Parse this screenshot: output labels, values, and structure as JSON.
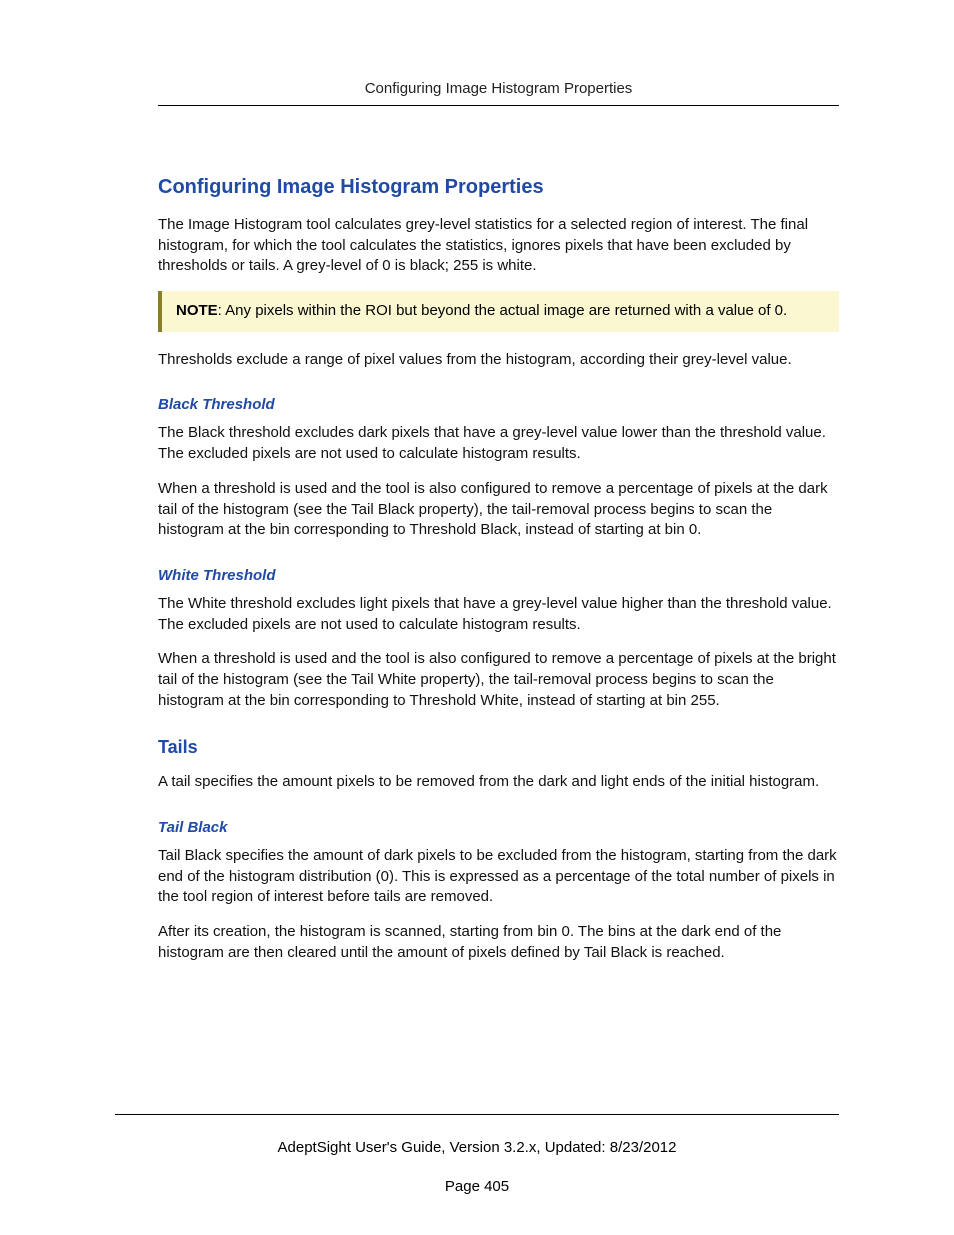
{
  "header": {
    "running_title": "Configuring Image Histogram Properties"
  },
  "content": {
    "h1": "Configuring Image Histogram Properties",
    "intro": "The Image Histogram tool calculates grey-level statistics for a selected region of interest. The final histogram, for which the tool calculates the statistics, ignores pixels that have been excluded by thresholds or tails. A grey-level of 0 is black; 255 is white.",
    "note_label": "NOTE",
    "note_text": ": Any pixels within the ROI but beyond the actual image are returned with a value of 0.",
    "thresholds_intro": "Thresholds exclude a range of pixel values from the histogram, according their grey-level value.",
    "black_threshold": {
      "heading": "Black Threshold",
      "p1": "The Black threshold excludes dark pixels that have a grey-level value lower than the threshold value. The excluded pixels are not used to calculate histogram results.",
      "p2": "When a threshold is used and the tool is also configured to remove a percentage of pixels at the dark tail of the histogram (see the Tail Black property), the tail-removal process begins to scan the histogram at the bin corresponding to Threshold Black, instead of starting at bin 0."
    },
    "white_threshold": {
      "heading": "White Threshold",
      "p1": "The White threshold excludes light pixels that have a grey-level value higher than the threshold value. The excluded pixels are not used to calculate histogram results.",
      "p2": "When a threshold is used and the tool is also configured to remove a percentage of pixels at the bright tail of the histogram (see the Tail White property), the tail-removal process begins to scan the histogram at the bin corresponding to Threshold White, instead of starting at bin 255."
    },
    "tails": {
      "heading": "Tails",
      "intro": "A tail specifies the amount pixels to be removed from the dark and light ends of the initial histogram."
    },
    "tail_black": {
      "heading": "Tail Black",
      "p1": "Tail Black specifies the amount of dark pixels to be excluded from the histogram, starting from the dark end of the histogram distribution (0). This is expressed as a percentage of the total number of pixels in the tool region of interest before tails are removed.",
      "p2": "After its creation, the histogram is scanned, starting from bin 0. The bins at the dark end of the histogram are then cleared until the amount of pixels defined by Tail Black is reached."
    }
  },
  "footer": {
    "line1": "AdeptSight User's Guide,  Version 3.2.x, Updated: 8/23/2012",
    "page": "Page 405"
  }
}
